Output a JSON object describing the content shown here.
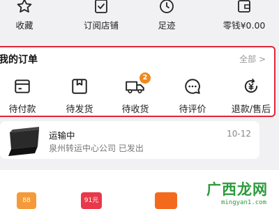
{
  "quick_links": [
    {
      "label": "收藏",
      "icon": "star-icon"
    },
    {
      "label": "订阅店铺",
      "icon": "subscribe-icon"
    },
    {
      "label": "足迹",
      "icon": "clock-icon"
    },
    {
      "label": "零钱¥0.00",
      "icon": "wallet-icon"
    }
  ],
  "orders": {
    "title": "我的订单",
    "all_label": "全部 >",
    "items": [
      {
        "label": "待付款",
        "icon": "card-icon"
      },
      {
        "label": "待发货",
        "icon": "package-icon"
      },
      {
        "label": "待收货",
        "icon": "truck-icon",
        "badge": "2"
      },
      {
        "label": "待评价",
        "icon": "comment-icon"
      },
      {
        "label": "退款/售后",
        "icon": "refund-icon"
      }
    ]
  },
  "logistics": {
    "status": "运输中",
    "date": "10-12",
    "detail": "泉州转运中心公司 已发出"
  },
  "bottom_badges": [
    "88",
    "91元"
  ],
  "watermark": {
    "text": "广西龙网",
    "url": "mingyan1.com"
  },
  "colors": {
    "accent": "#e0263a",
    "badge": "#f0891a",
    "watermark": "#2c9a3c"
  }
}
